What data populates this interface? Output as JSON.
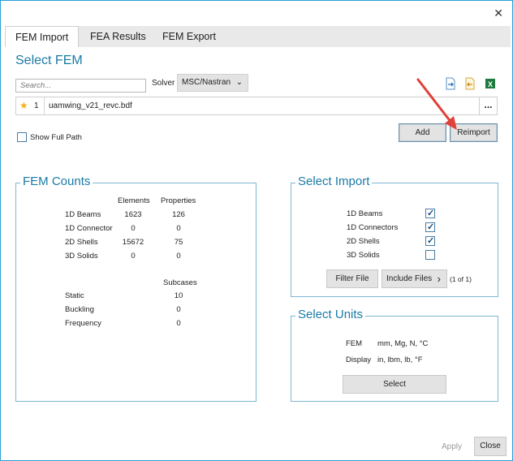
{
  "window": {
    "close_glyph": "✕"
  },
  "tabs": [
    {
      "label": "FEM Import",
      "active": true
    },
    {
      "label": "FEA Results",
      "active": false
    },
    {
      "label": "FEM Export",
      "active": false
    }
  ],
  "select_fem": {
    "title": "Select FEM",
    "search_placeholder": "Search...",
    "solver_label": "Solver",
    "solver_value": "MSC/Nastran",
    "toolbar_icons": [
      "import-file-icon",
      "export-file-icon",
      "excel-icon"
    ],
    "file": {
      "index": "1",
      "name": "uamwing_v21_revc.bdf",
      "more_label": "..."
    },
    "add_label": "Add",
    "reimport_label": "Reimport",
    "show_full_path_label": "Show Full Path",
    "show_full_path_checked": false
  },
  "fem_counts": {
    "title": "FEM Counts",
    "elements_header": "Elements",
    "properties_header": "Properties",
    "rows": [
      {
        "label": "1D Beams",
        "elements": "1623",
        "properties": "126"
      },
      {
        "label": "1D Connector",
        "elements": "0",
        "properties": "0"
      },
      {
        "label": "2D Shells",
        "elements": "15672",
        "properties": "75"
      },
      {
        "label": "3D Solids",
        "elements": "0",
        "properties": "0"
      }
    ],
    "subcases_header": "Subcases",
    "subcases": [
      {
        "label": "Static",
        "value": "10"
      },
      {
        "label": "Buckling",
        "value": "0"
      },
      {
        "label": "Frequency",
        "value": "0"
      }
    ]
  },
  "select_import": {
    "title": "Select Import",
    "items": [
      {
        "label": "1D Beams",
        "checked": true
      },
      {
        "label": "1D Connectors",
        "checked": true
      },
      {
        "label": "2D Shells",
        "checked": true
      },
      {
        "label": "3D Solids",
        "checked": false
      }
    ],
    "filter_file_label": "Filter File",
    "include_files_label": "Include Files",
    "include_files_chevron": "›",
    "include_count": "(1 of 1)"
  },
  "select_units": {
    "title": "Select Units",
    "fem_label": "FEM",
    "fem_units": "mm, Mg, N, °C",
    "display_label": "Display",
    "display_units": "in, lbm, lb, °F",
    "select_label": "Select"
  },
  "footer": {
    "apply_label": "Apply",
    "close_label": "Close"
  },
  "colors": {
    "accent": "#1a7aa6",
    "annotation_arrow": "#e0413a"
  }
}
